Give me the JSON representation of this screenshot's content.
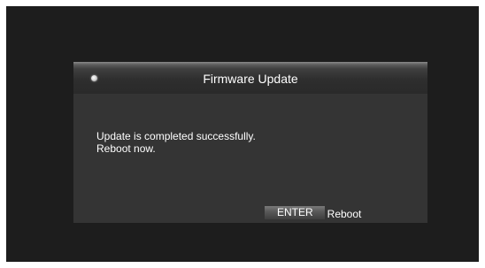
{
  "dialog": {
    "title": "Firmware Update",
    "message_lines": [
      "Update is completed successfully.",
      "Reboot now."
    ]
  },
  "footer": {
    "key_label": "ENTER",
    "action_label": "Reboot"
  },
  "icons": {
    "title_indicator": "indicator-light-icon"
  },
  "colors": {
    "screen_background": "#1d1d1d",
    "dialog_background": "#343434",
    "text": "#ffffff"
  }
}
